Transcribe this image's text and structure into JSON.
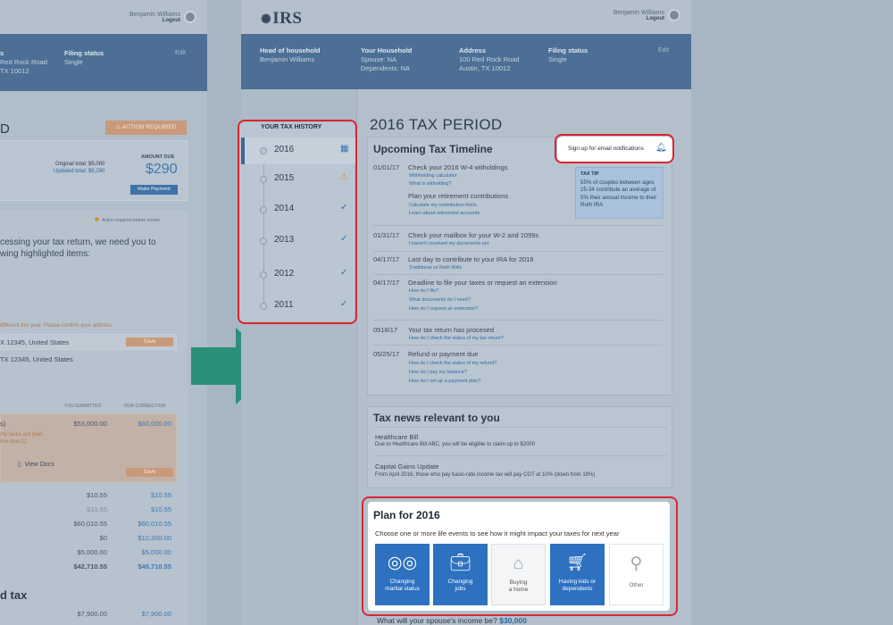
{
  "user": {
    "name": "Benjamin Williams",
    "logout": "Logout"
  },
  "left_screen": {
    "header": {
      "address_partial": [
        "s",
        "Red Rock Road",
        "TX 10012"
      ],
      "filing_status_label": "Filing status",
      "filing_status_value": "Single",
      "edit": "Edit"
    },
    "period_fragment": "D",
    "action_required": "ACTION REQUIRED",
    "amount_due_label": "AMOUNT DUE",
    "original_total": "Original total: $5,000",
    "updated_total": "Updated total: $5,290",
    "amount_due": "$290",
    "make_payment": "Make Payment",
    "action_note": "Action required before review",
    "processing_line1": "cessing your tax return, we need you to",
    "processing_line2": "wing highlighted items:",
    "address_note": "different this year. Please confirm your address.",
    "address_input": "X 12345, United States",
    "save": "Save",
    "address_alt": "TX 12345, United States",
    "col_submitted": "YOU SUBMITTED",
    "col_correction": "OUR CORRECTION",
    "row_label": "s)",
    "row_submitted": "$53,000.00",
    "row_correction": "$60,000.00",
    "row_note1": "my taxes are paid.",
    "row_note2": "line dow 22",
    "view_docs": "View Docs",
    "rows": [
      {
        "a": "$10.55",
        "b": "$10.55"
      },
      {
        "a": "$10.55",
        "b": "$10.55"
      },
      {
        "a": "$60,010.55",
        "b": "$60,010.55"
      },
      {
        "a": "$0",
        "b": "$10,300.00"
      },
      {
        "a": "$5,000.00",
        "b": "$5,000.00"
      },
      {
        "a": "$42,710.55",
        "b": "$49,710.55"
      }
    ],
    "section_fragment": "d tax",
    "bottom_row": {
      "a": "$7,900.00",
      "b": "$7,900.00"
    }
  },
  "header": {
    "logo": "IRS",
    "head_label": "Head of household",
    "head_value": "Benjamin Williams",
    "household_label": "Your Household",
    "spouse": "Spouse: NA",
    "dependents": "Dependents: NA",
    "address_label": "Address",
    "address_line1": "100 Red Rock Road",
    "address_line2": "Austin, TX 10012",
    "filing_label": "Filing status",
    "filing_value": "Single",
    "edit": "Edit"
  },
  "history": {
    "title": "YOUR TAX HISTORY",
    "items": [
      {
        "year": "2016",
        "status": "calendar-icon"
      },
      {
        "year": "2015",
        "status": "warning-icon"
      },
      {
        "year": "2014",
        "status": "check-icon"
      },
      {
        "year": "2013",
        "status": "check-icon"
      },
      {
        "year": "2012",
        "status": "check-icon"
      },
      {
        "year": "2011",
        "status": "check-icon"
      }
    ]
  },
  "period_title": "2016 TAX PERIOD",
  "timeline": {
    "title": "Upcoming Tax Timeline",
    "notify": "Sign up for email notifications",
    "entries": [
      {
        "date": "01/01/17",
        "text": "Check your 2016 W-4 witholdings",
        "links": [
          "Withholding calculator",
          "What is witholding?"
        ]
      },
      {
        "date": "",
        "text": "Plan your retirement contributions",
        "links": [
          "Calculate my contribution limits",
          "Learn about retirement accounts"
        ]
      },
      {
        "date": "01/31/17",
        "text": "Check your mailbox for your W-2 and 1099s",
        "links": [
          "I haven't received my documents yet"
        ]
      },
      {
        "date": "04/17/17",
        "text": "Last day to contribute to your IRA for 2016",
        "links": [
          "Traditional vs Roth IRAs"
        ]
      },
      {
        "date": "04/17/17",
        "text": "Deadline to file your taxes or request an extension",
        "links": [
          "How do I file?",
          "What documents do I need?",
          "How do I request an extension?"
        ]
      },
      {
        "date": "0518/17",
        "text": "Your tax return has procesed",
        "links": [
          "How do I check the status of my tax return?"
        ]
      },
      {
        "date": "05/25/17",
        "text": "Refund or payment due",
        "links": [
          "How do I check the status of my refund?",
          "How do I pay my balance?",
          "How do I set up a payment plan?"
        ]
      }
    ],
    "tip_title": "TAX TIP",
    "tip_body": "55% of couples between ages 25-34 contribute an average of 5% their annual income to their Roth IRA"
  },
  "news": {
    "title": "Tax news relevant to you",
    "items": [
      {
        "headline": "Healthcare Bill",
        "body": "Due to Healthcare Bill ABC, you will be eligible to claim up to $2000"
      },
      {
        "headline": "Capital Gains Update",
        "body": "From April 2016, those who pay basic-rate income tax will pay CGT at 10% (down from 18%)"
      }
    ]
  },
  "plan": {
    "title": "Plan for 2016",
    "subtitle": "Choose one or more life events to see how it might impact your taxes for next year",
    "tiles": [
      {
        "label1": "Changing",
        "label2": "marital status",
        "icon": "rings-icon"
      },
      {
        "label1": "Changing",
        "label2": "jobs",
        "icon": "briefcase-icon"
      },
      {
        "label1": "Buying",
        "label2": "a home",
        "icon": "house-icon"
      },
      {
        "label1": "Having kids or",
        "label2": "dependents",
        "icon": "stroller-icon"
      },
      {
        "label1": "Other",
        "label2": "",
        "icon": "magnifier-icon"
      }
    ]
  },
  "spouse_question": "What will your spouse's income be?",
  "spouse_amount": "$30,000",
  "colors": {
    "header_blue": "#4d6f95",
    "tile_blue": "#2d71c0",
    "highlight_red": "#d9272e",
    "arrow_teal": "#2a9079"
  }
}
